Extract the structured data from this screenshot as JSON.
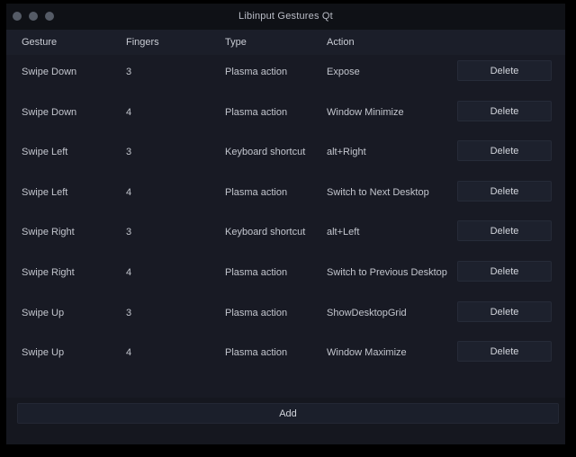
{
  "window": {
    "title": "Libinput Gestures Qt",
    "controls": [
      {
        "name": "close",
        "color": "#555b66"
      },
      {
        "name": "minimize",
        "color": "#555b66"
      },
      {
        "name": "maximize",
        "color": "#555b66"
      }
    ],
    "background": "#181a24",
    "titlebar_background": "#0f1116"
  },
  "table": {
    "headers": [
      "Gesture",
      "Fingers",
      "Type",
      "Action"
    ],
    "rows": [
      {
        "gesture": "Swipe Down",
        "fingers": "3",
        "type": "Plasma action",
        "action": "Expose",
        "delete_label": "Delete"
      },
      {
        "gesture": "Swipe Down",
        "fingers": "4",
        "type": "Plasma action",
        "action": "Window Minimize",
        "delete_label": "Delete"
      },
      {
        "gesture": "Swipe Left",
        "fingers": "3",
        "type": "Keyboard shortcut",
        "action": "alt+Right",
        "delete_label": "Delete"
      },
      {
        "gesture": "Swipe Left",
        "fingers": "4",
        "type": "Plasma action",
        "action": "Switch to Next Desktop",
        "delete_label": "Delete"
      },
      {
        "gesture": "Swipe Right",
        "fingers": "3",
        "type": "Keyboard shortcut",
        "action": "alt+Left",
        "delete_label": "Delete"
      },
      {
        "gesture": "Swipe Right",
        "fingers": "4",
        "type": "Plasma action",
        "action": "Switch to Previous Desktop",
        "delete_label": "Delete"
      },
      {
        "gesture": "Swipe Up",
        "fingers": "3",
        "type": "Plasma action",
        "action": "ShowDesktopGrid",
        "delete_label": "Delete"
      },
      {
        "gesture": "Swipe Up",
        "fingers": "4",
        "type": "Plasma action",
        "action": "Window Maximize",
        "delete_label": "Delete"
      }
    ]
  },
  "footer": {
    "add_label": "Add"
  }
}
